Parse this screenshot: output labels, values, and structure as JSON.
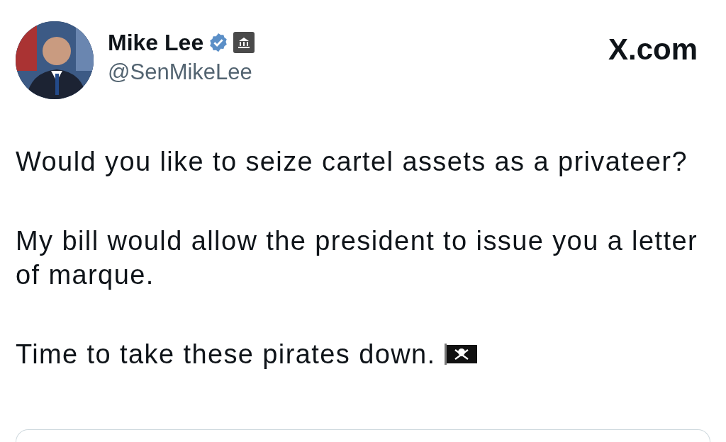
{
  "author": {
    "name": "Mike Lee",
    "verified": true,
    "handle": "@SenMikeLee"
  },
  "site": "X.com",
  "paragraphs": [
    {
      "text": "Would you like to seize cartel assets as a privateer?",
      "flag": false
    },
    {
      "text": "My bill would allow the president to issue you a letter of marque.",
      "flag": false
    },
    {
      "text": "Time to take these pirates down.",
      "flag": true
    }
  ]
}
